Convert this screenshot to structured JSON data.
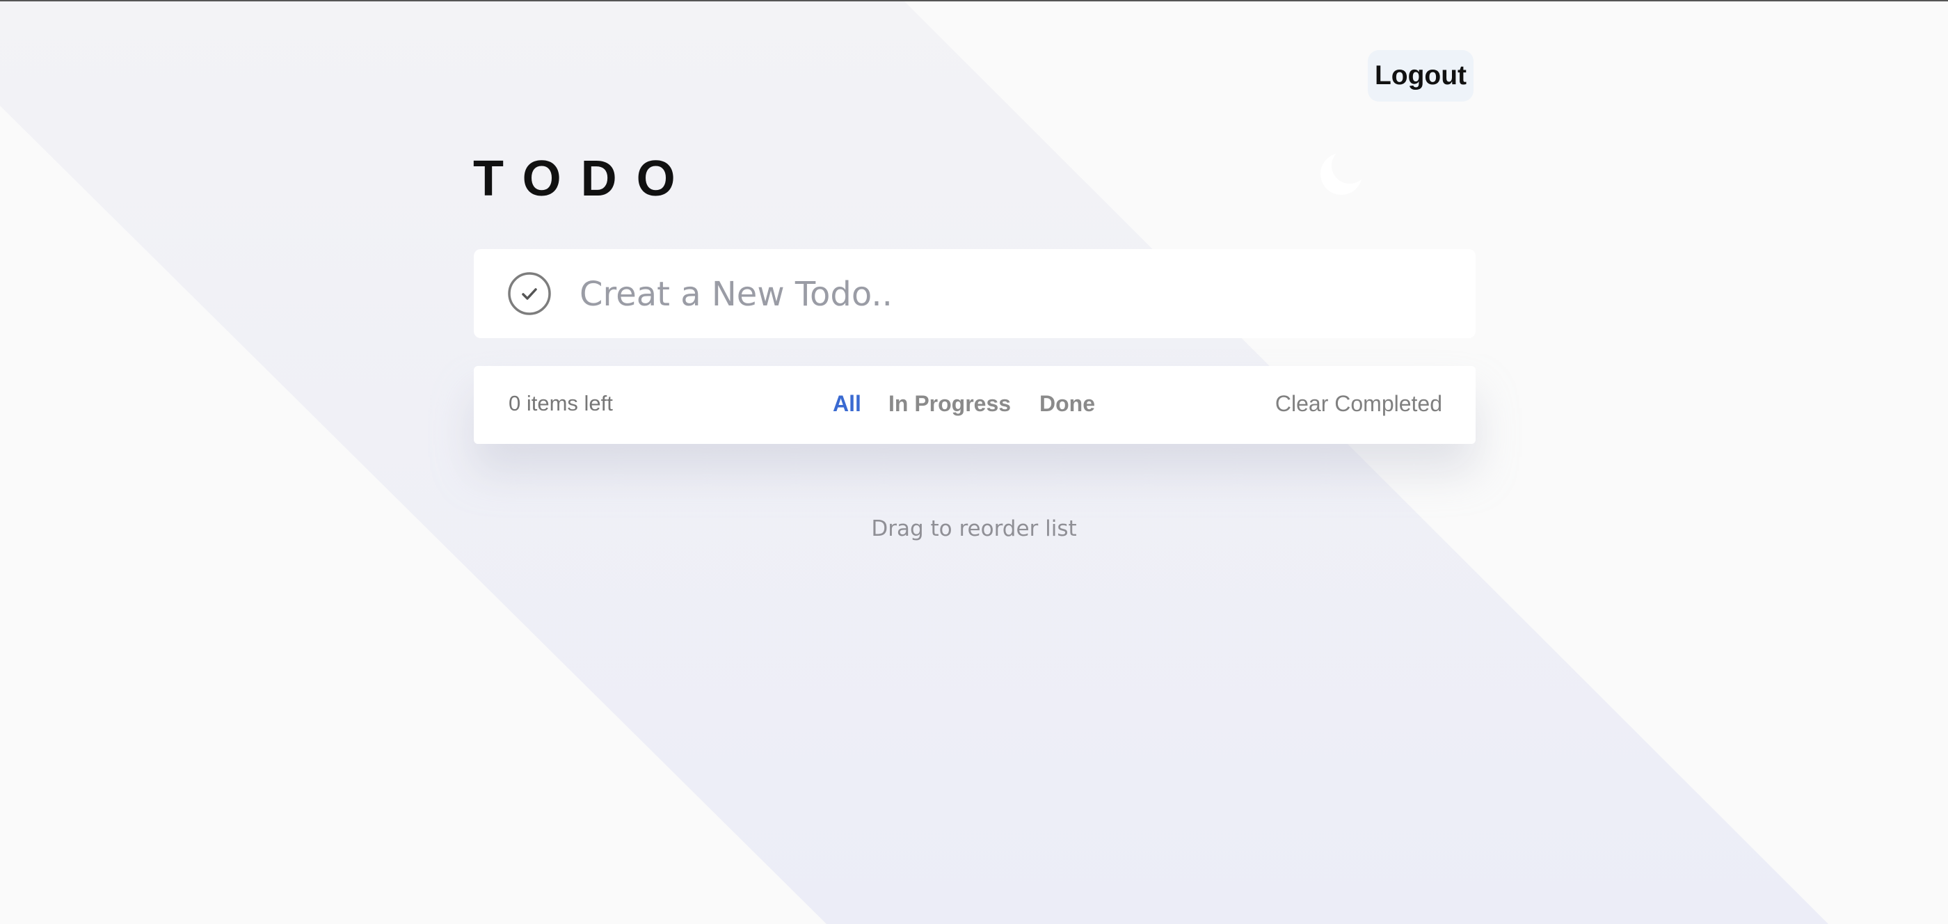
{
  "header": {
    "logout_label": "Logout",
    "title": "TODO",
    "theme_toggle_icon": "moon-icon"
  },
  "new_todo": {
    "check_icon": "check-circle-icon",
    "placeholder": "Creat a New Todo..",
    "value": ""
  },
  "filter_bar": {
    "items_left": "0 items left",
    "filters": [
      {
        "label": "All",
        "active": true
      },
      {
        "label": "In Progress",
        "active": false
      },
      {
        "label": "Done",
        "active": false
      }
    ],
    "clear_label": "Clear Completed"
  },
  "hint": "Drag to reorder list",
  "colors": {
    "accent": "#3a6ad1",
    "background": "#fafafa",
    "band": "#eeeff7",
    "card": "#ffffff"
  }
}
